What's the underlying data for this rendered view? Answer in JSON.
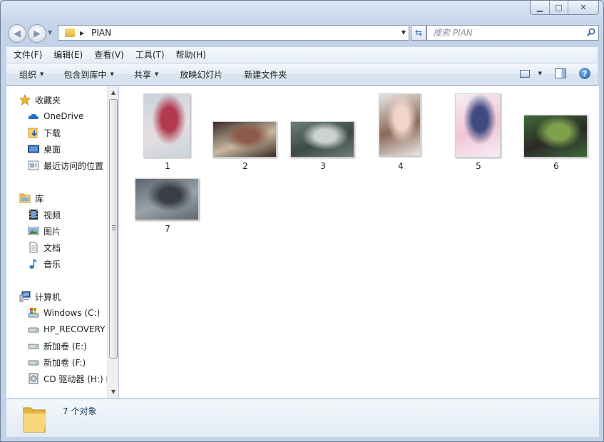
{
  "window": {
    "caption": {
      "minimize": "▁",
      "maximize": "□",
      "close": "✕"
    }
  },
  "nav": {
    "address_path": "PIAN",
    "search_placeholder": "搜索 PIAN"
  },
  "menubar": {
    "items": [
      "文件(F)",
      "编辑(E)",
      "查看(V)",
      "工具(T)",
      "帮助(H)"
    ]
  },
  "toolbar": {
    "organize": "组织",
    "include_in_library": "包含到库中",
    "share": "共享",
    "slideshow": "放映幻灯片",
    "new_folder": "新建文件夹"
  },
  "sidebar": {
    "favorites": {
      "label": "收藏夹",
      "items": [
        "OneDrive",
        "下载",
        "桌面",
        "最近访问的位置"
      ]
    },
    "libraries": {
      "label": "库",
      "items": [
        "视频",
        "图片",
        "文档",
        "音乐"
      ]
    },
    "computer": {
      "label": "计算机",
      "items": [
        "Windows  (C:)",
        "HP_RECOVERY",
        "新加卷 (E:)",
        "新加卷 (F:)",
        "CD 驱动器 (H:) H"
      ]
    }
  },
  "files": [
    {
      "name": "1",
      "orientation": "portrait",
      "colors": [
        "#c9d3dd",
        "#b23a4e",
        "#e6dfe0"
      ]
    },
    {
      "name": "2",
      "orientation": "landscape",
      "colors": [
        "#3b2a27",
        "#8b5a4a",
        "#c8b8a0"
      ]
    },
    {
      "name": "3",
      "orientation": "landscape",
      "colors": [
        "#6f7e78",
        "#cbd2d0",
        "#3b4a46"
      ]
    },
    {
      "name": "4",
      "orientation": "portrait",
      "colors": [
        "#e9e6e4",
        "#f1d5c8",
        "#8c6a58"
      ]
    },
    {
      "name": "5",
      "orientation": "portrait",
      "colors": [
        "#f4eef6",
        "#3e4a80",
        "#f2c5d5"
      ]
    },
    {
      "name": "6",
      "orientation": "landscape",
      "colors": [
        "#3f6a3a",
        "#7ea14c",
        "#2a2a26"
      ]
    },
    {
      "name": "7",
      "orientation": "landscape",
      "colors": [
        "#5b6771",
        "#3b3f45",
        "#9aa2a8"
      ]
    }
  ],
  "status": {
    "count_text": "7 个对象"
  }
}
